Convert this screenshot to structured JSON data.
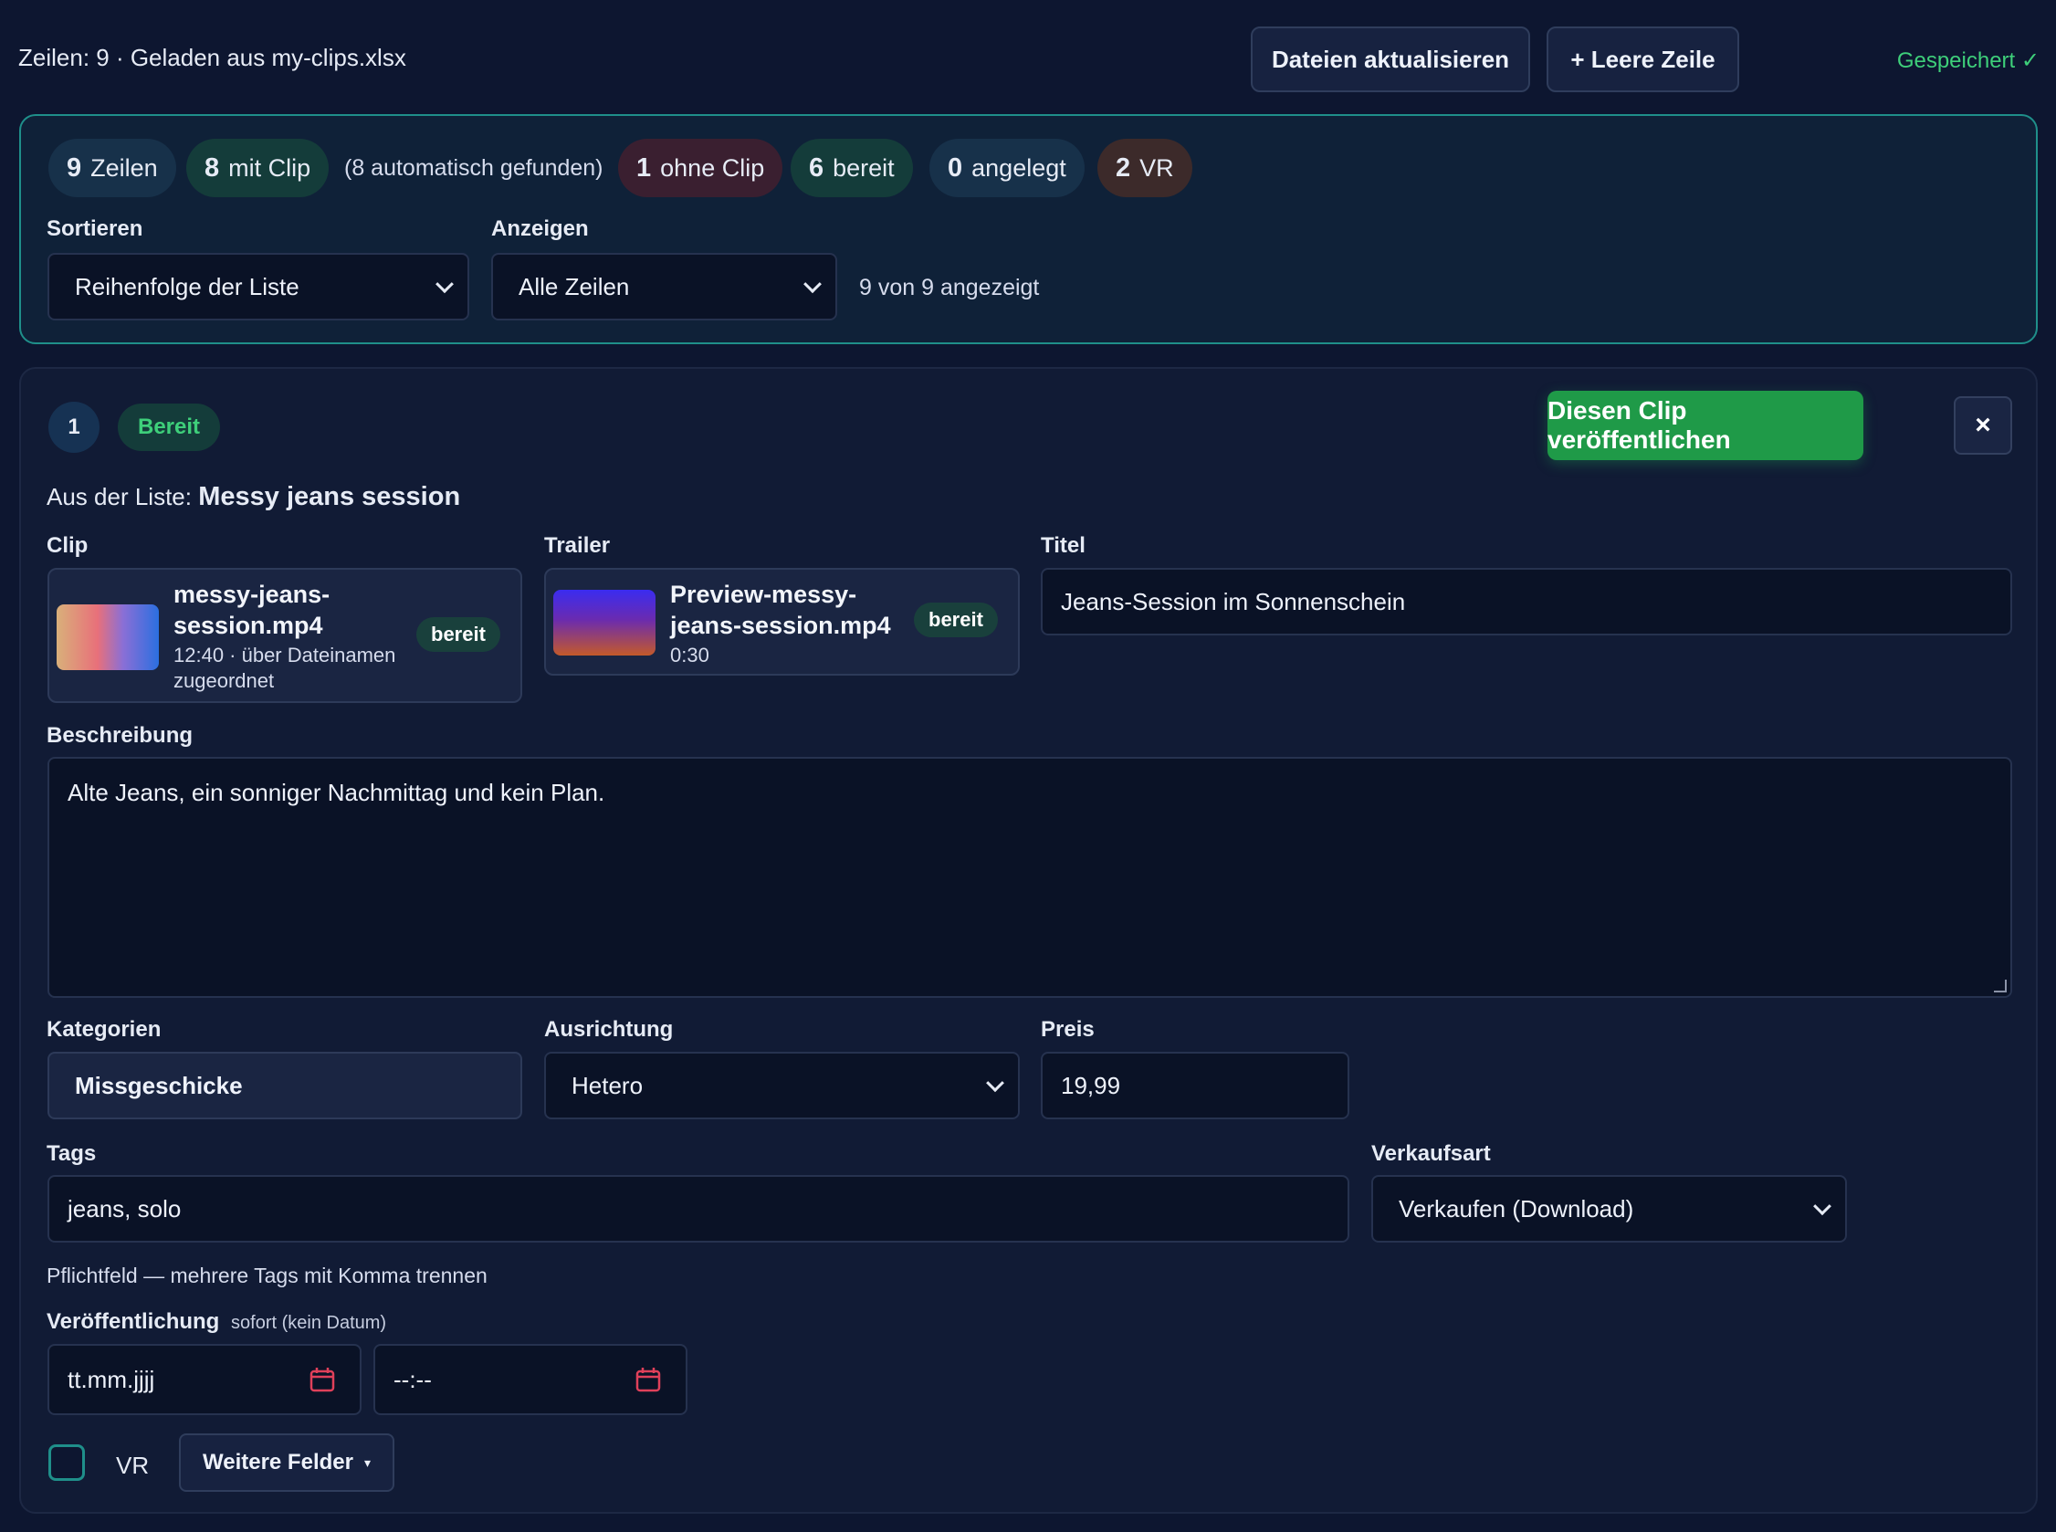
{
  "header": {
    "status": "Zeilen: 9 · Geladen aus my-clips.xlsx",
    "refresh_label": "Dateien aktualisieren",
    "add_row_label": "+ Leere Zeile",
    "saved_label": "Gespeichert ✓"
  },
  "summary": {
    "chips": {
      "rows": {
        "count": "9",
        "label": "Zeilen"
      },
      "with_clip": {
        "count": "8",
        "label": "mit Clip"
      },
      "auto_found": "(8 automatisch gefunden)",
      "without_clip": {
        "count": "1",
        "label": "ohne Clip"
      },
      "ready": {
        "count": "6",
        "label": "bereit"
      },
      "created": {
        "count": "0",
        "label": "angelegt"
      },
      "vr": {
        "count": "2",
        "label": "VR"
      }
    },
    "sort_label": "Sortieren",
    "sort_value": "Reihenfolge der Liste",
    "show_label": "Anzeigen",
    "show_value": "Alle Zeilen",
    "shown_count": "9 von 9 angezeigt"
  },
  "card": {
    "index": "1",
    "status": "Bereit",
    "publish_label": "Diesen Clip veröffentlichen",
    "close_label": "×",
    "source_prefix": "Aus der Liste:",
    "source_title": "Messy jeans session",
    "clip": {
      "label": "Clip",
      "filename_line1": "messy-jeans-",
      "filename_line2": "session.mp4",
      "meta_line1": "12:40 · über Dateinamen",
      "meta_line2": "zugeordnet",
      "state": "bereit"
    },
    "trailer": {
      "label": "Trailer",
      "filename_line1": "Preview-messy-",
      "filename_line2": "jeans-session.mp4",
      "meta": "0:30",
      "state": "bereit"
    },
    "title": {
      "label": "Titel",
      "value": "Jeans-Session im Sonnenschein"
    },
    "description": {
      "label": "Beschreibung",
      "value": "Alte Jeans, ein sonniger Nachmittag und kein Plan."
    },
    "categories": {
      "label": "Kategorien",
      "value": "Missgeschicke"
    },
    "orientation": {
      "label": "Ausrichtung",
      "value": "Hetero"
    },
    "price": {
      "label": "Preis",
      "value": "19,99"
    },
    "tags": {
      "label": "Tags",
      "value": "jeans, solo",
      "help": "Pflichtfeld — mehrere Tags mit Komma trennen"
    },
    "sale_type": {
      "label": "Verkaufsart",
      "value": "Verkaufen (Download)"
    },
    "publication": {
      "label": "Veröffentlichung",
      "note": "sofort (kein Datum)",
      "date_placeholder": "tt.mm.jjjj",
      "time_placeholder": "--:--"
    },
    "vr_label": "VR",
    "more_fields_label": "Weitere Felder",
    "more_fields_caret": "▾"
  },
  "colors": {
    "background": "#0d1630",
    "accent_green": "#1f9a48",
    "saved_green": "#3ecf7a",
    "panel_border": "#1f8f8a",
    "calendar_icon": "#e0405a"
  }
}
